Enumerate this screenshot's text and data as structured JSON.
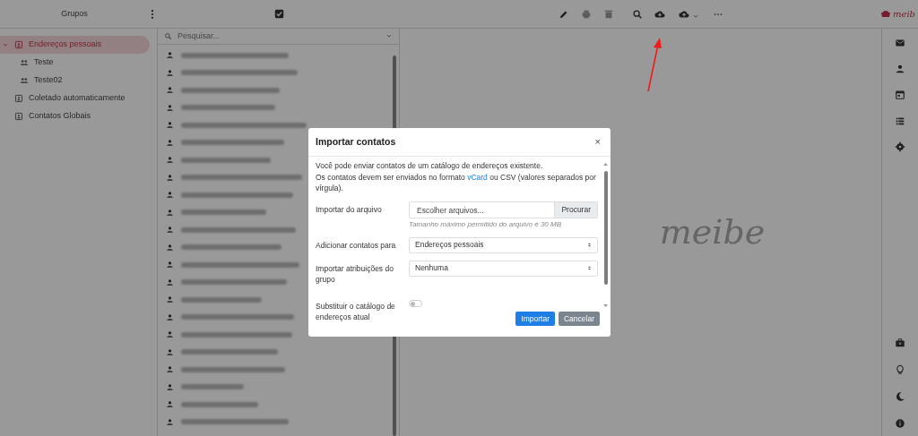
{
  "topbar": {
    "groups_title": "Grupos",
    "logo": "meib",
    "toolbar": [
      {
        "kind": "edit",
        "disabled": false
      },
      {
        "kind": "print",
        "disabled": true
      },
      {
        "kind": "delete",
        "disabled": true
      },
      {
        "kind": "search",
        "disabled": false
      },
      {
        "kind": "import",
        "disabled": false
      },
      {
        "kind": "export",
        "disabled": false
      },
      {
        "kind": "more",
        "disabled": false
      }
    ]
  },
  "groups": [
    {
      "label": "Endereços pessoais",
      "kind": "addressbook",
      "selected": true,
      "expanded": true,
      "children": [
        {
          "label": "Teste",
          "kind": "group",
          "selected": false
        },
        {
          "label": "Teste02",
          "kind": "group",
          "selected": false
        }
      ]
    },
    {
      "label": "Coletado automaticamente",
      "kind": "addressbook",
      "selected": false
    },
    {
      "label": "Contatos Globais",
      "kind": "addressbook",
      "selected": false
    }
  ],
  "search": {
    "placeholder": "Pesquisar..."
  },
  "contacts": [
    {
      "kind": "redacted"
    },
    {
      "kind": "redacted"
    },
    {
      "kind": "redacted"
    },
    {
      "kind": "redacted"
    },
    {
      "kind": "redacted"
    },
    {
      "kind": "redacted"
    },
    {
      "kind": "redacted"
    },
    {
      "kind": "redacted"
    },
    {
      "kind": "redacted"
    },
    {
      "kind": "redacted"
    },
    {
      "kind": "redacted"
    },
    {
      "kind": "redacted"
    },
    {
      "kind": "redacted"
    },
    {
      "kind": "redacted"
    },
    {
      "kind": "redacted"
    },
    {
      "kind": "redacted"
    },
    {
      "kind": "redacted"
    },
    {
      "kind": "redacted"
    },
    {
      "kind": "redacted"
    },
    {
      "kind": "redacted"
    },
    {
      "kind": "redacted"
    },
    {
      "kind": "redacted"
    }
  ],
  "empty_logo": "meibe",
  "right_sidebar": {
    "top": [
      {
        "kind": "mail"
      },
      {
        "kind": "contacts"
      },
      {
        "kind": "calendar"
      },
      {
        "kind": "tasks"
      },
      {
        "kind": "settings"
      }
    ],
    "bottom": [
      {
        "kind": "briefcase"
      },
      {
        "kind": "bulb"
      },
      {
        "kind": "moon"
      },
      {
        "kind": "info"
      }
    ]
  },
  "modal": {
    "title": "Importar contatos",
    "close": "×",
    "intro": "Você pode enviar contatos de um catálogo de endereços existente.",
    "format_before": "Os contatos devem ser enviados no formato ",
    "format_link": "vCard",
    "format_after": " ou CSV (valores separados por vírgula).",
    "fields": [
      {
        "kind": "file",
        "label": "Importar do arquivo",
        "placeholder": "Escolher arquivos...",
        "button": "Procurar",
        "hint": "Tamanho máximo permitido do arquivo é 30 MB"
      },
      {
        "kind": "select",
        "label": "Adicionar contatos para",
        "value": "Endereços pessoais"
      },
      {
        "kind": "select",
        "label": "Importar atribuições do grupo",
        "value": "Nenhuma"
      },
      {
        "kind": "switch",
        "label": "Substituir o catálogo de endereços atual",
        "on": false
      }
    ],
    "buttons": [
      {
        "label": "Importar",
        "kind": "primary"
      },
      {
        "label": "Cancelar",
        "kind": "secondary"
      }
    ]
  },
  "annotation": {
    "kind": "arrow"
  }
}
